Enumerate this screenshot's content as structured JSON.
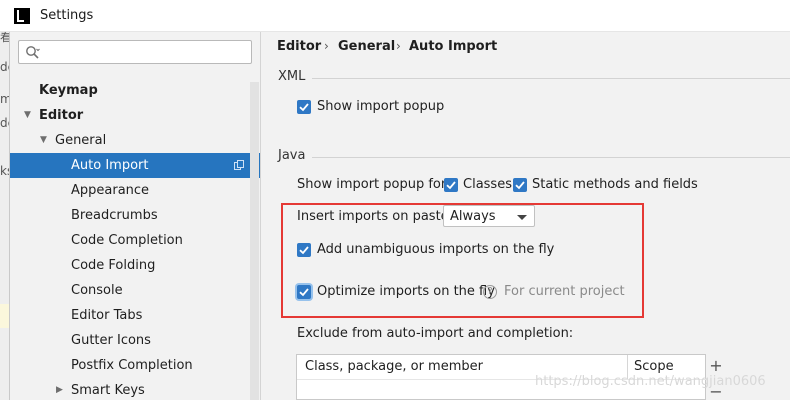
{
  "window": {
    "title": "Settings"
  },
  "background_window": {
    "fragments": [
      "看",
      "de",
      "m",
      "de",
      "ks"
    ]
  },
  "sidebar": {
    "search": {
      "placeholder": ""
    },
    "tree": [
      {
        "label": "Keymap",
        "level": 0,
        "bold": true
      },
      {
        "label": "Editor",
        "level": 0,
        "bold": true,
        "expanded": true
      },
      {
        "label": "General",
        "level": 1,
        "expanded": true
      },
      {
        "label": "Auto Import",
        "level": 2,
        "selected": true
      },
      {
        "label": "Appearance",
        "level": 2
      },
      {
        "label": "Breadcrumbs",
        "level": 2
      },
      {
        "label": "Code Completion",
        "level": 2
      },
      {
        "label": "Code Folding",
        "level": 2
      },
      {
        "label": "Console",
        "level": 2
      },
      {
        "label": "Editor Tabs",
        "level": 2
      },
      {
        "label": "Gutter Icons",
        "level": 2
      },
      {
        "label": "Postfix Completion",
        "level": 2
      },
      {
        "label": "Smart Keys",
        "level": 2,
        "collapsed": true
      }
    ]
  },
  "main": {
    "breadcrumb": [
      "Editor",
      "General",
      "Auto Import"
    ],
    "xml": {
      "title": "XML",
      "show_import_popup": {
        "label": "Show import popup",
        "checked": true
      }
    },
    "java": {
      "title": "Java",
      "popup_for_label": "Show import popup for:",
      "classes": {
        "label": "Classes",
        "checked": true
      },
      "static_methods": {
        "label": "Static methods and fields",
        "checked": true
      },
      "insert_on_paste": {
        "label": "Insert imports on paste:",
        "value": "Always"
      },
      "add_unambiguous": {
        "label": "Add unambiguous imports on the fly",
        "checked": true
      },
      "optimize": {
        "label": "Optimize imports on the fly",
        "checked": true,
        "hint": "For current project"
      },
      "exclude_label": "Exclude from auto-import and completion:",
      "exclude_table": {
        "columns": [
          "Class, package, or member",
          "Scope"
        ]
      }
    },
    "table_buttons": [
      "+",
      "−"
    ]
  },
  "watermark": "https://blog.csdn.net/wangjian0606",
  "colors": {
    "accent": "#2f78c5",
    "selection": "#2675bf",
    "highlight_box": "#e53935"
  }
}
